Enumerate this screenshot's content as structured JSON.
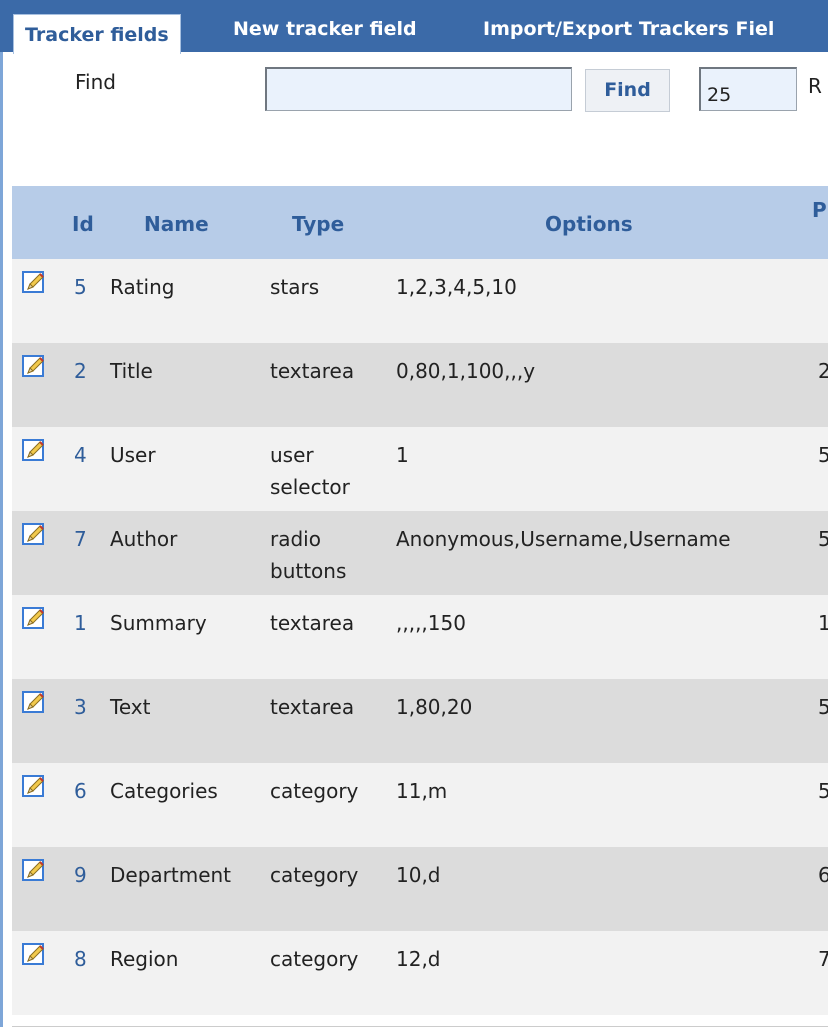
{
  "tabs": [
    {
      "label": "Tracker fields",
      "active": true
    },
    {
      "label": "New tracker field",
      "active": false
    },
    {
      "label": "Import/Export Trackers Fiel",
      "active": false
    }
  ],
  "find": {
    "label": "Find",
    "value": "",
    "button_label": "Find",
    "max_records": "25",
    "max_records_label": "R"
  },
  "table": {
    "headers": {
      "id": "Id",
      "name": "Name",
      "type": "Type",
      "options": "Options",
      "position": "P"
    },
    "rows": [
      {
        "id": "5",
        "name": "Rating",
        "type": "stars",
        "options": "1,2,3,4,5,10",
        "position": ""
      },
      {
        "id": "2",
        "name": "Title",
        "type": "textarea",
        "options": "0,80,1,100,,,y",
        "position": "2"
      },
      {
        "id": "4",
        "name": "User",
        "type": "user selector",
        "options": "1",
        "position": "5"
      },
      {
        "id": "7",
        "name": "Author",
        "type": "radio buttons",
        "options": "Anonymous,Username,Username",
        "position": "5"
      },
      {
        "id": "1",
        "name": "Summary",
        "type": "textarea",
        "options": ",,,,,150",
        "position": "1"
      },
      {
        "id": "3",
        "name": "Text",
        "type": "textarea",
        "options": "1,80,20",
        "position": "5"
      },
      {
        "id": "6",
        "name": "Categories",
        "type": "category",
        "options": "11,m",
        "position": "5"
      },
      {
        "id": "9",
        "name": "Department",
        "type": "category",
        "options": "10,d",
        "position": "6"
      },
      {
        "id": "8",
        "name": "Region",
        "type": "category",
        "options": "12,d",
        "position": "7"
      }
    ]
  },
  "icons": {
    "edit": "edit-pencil-icon"
  },
  "colors": {
    "tab_bar": "#3b6aa8",
    "header_bg": "#b7cce8",
    "accent_text": "#2f5d9a",
    "row_odd": "#f2f2f2",
    "row_even": "#dcdcdc",
    "input_bg": "#eaf2fc"
  }
}
